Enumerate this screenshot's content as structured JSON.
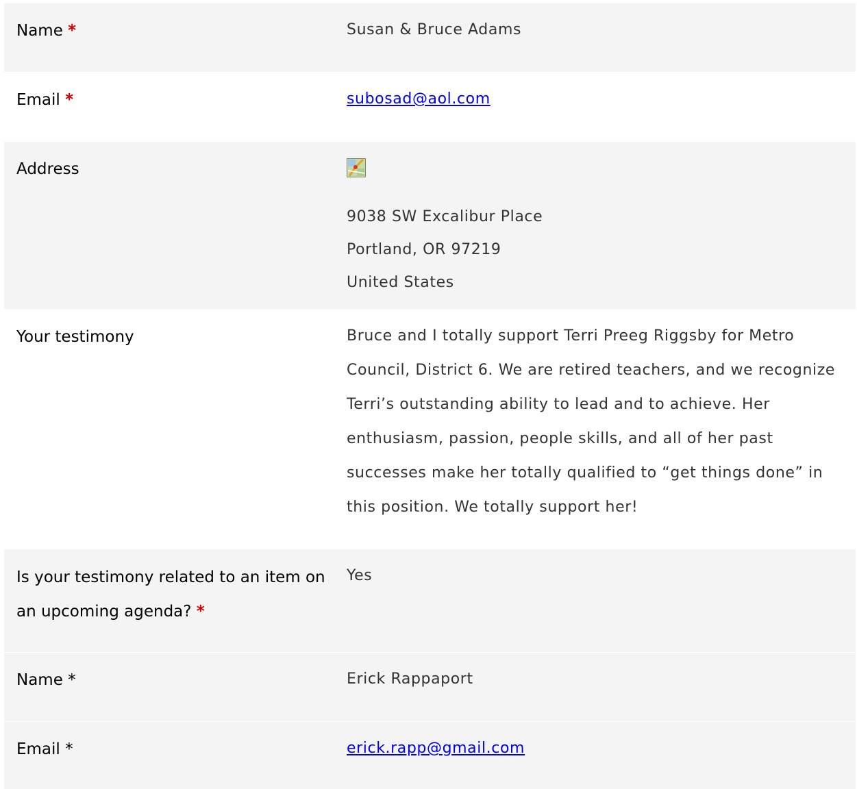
{
  "entries": [
    {
      "name": {
        "label": "Name",
        "required_mark": "*",
        "value": "Susan & Bruce Adams"
      },
      "email": {
        "label": "Email",
        "required_mark": "*",
        "value": "subosad@aol.com"
      },
      "address": {
        "label": "Address",
        "map_icon": "map-thumbnail-icon",
        "lines": [
          "9038 SW Excalibur Place",
          "Portland, OR 97219",
          "United States"
        ]
      },
      "testimony": {
        "label": "Your testimony",
        "value": "Bruce and I totally support Terri Preeg Riggsby for Metro Council, District 6. We are retired teachers, and we recognize Terri’s outstanding ability to lead and to achieve. Her enthusiasm, passion, people skills, and all of her past successes make her totally qualified to “get things done” in this position. We totally support her!"
      },
      "agenda": {
        "label": "Is your testimony related to an item on an upcoming agenda?",
        "required_mark": "*",
        "value": "Yes"
      }
    },
    {
      "name": {
        "label": "Name",
        "required_mark": "*",
        "value": "Erick Rappaport"
      },
      "email": {
        "label": "Email",
        "required_mark": "*",
        "value": "erick.rapp@gmail.com"
      }
    }
  ],
  "colors": {
    "required": "#d10000",
    "row_shaded": "#f4f4f4",
    "link": "#0000ee"
  }
}
